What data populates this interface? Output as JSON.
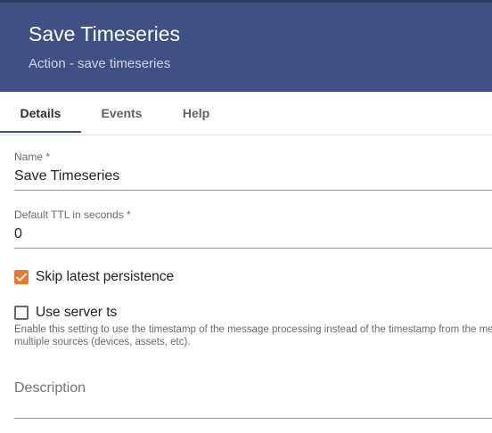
{
  "header": {
    "title": "Save Timeseries",
    "subtitle": "Action - save timeseries"
  },
  "tabs": [
    {
      "label": "Details",
      "active": true
    },
    {
      "label": "Events",
      "active": false
    },
    {
      "label": "Help",
      "active": false
    }
  ],
  "form": {
    "name": {
      "label": "Name *",
      "value": "Save Timeseries"
    },
    "ttl": {
      "label": "Default TTL in seconds *",
      "value": "0"
    },
    "skip_latest": {
      "label": "Skip latest persistence",
      "checked": true
    },
    "use_server_ts": {
      "label": "Use server ts",
      "checked": false,
      "hint_line1": "Enable this setting to use the timestamp of the message processing instead of the timestamp from the message. Useful for all sorts of sequential processing if you merge messages from",
      "hint_line2": "multiple sources (devices, assets, etc)."
    },
    "description": {
      "placeholder": "Description",
      "value": ""
    }
  },
  "colors": {
    "header_bg": "#3f5184",
    "accent": "#e9772f"
  }
}
